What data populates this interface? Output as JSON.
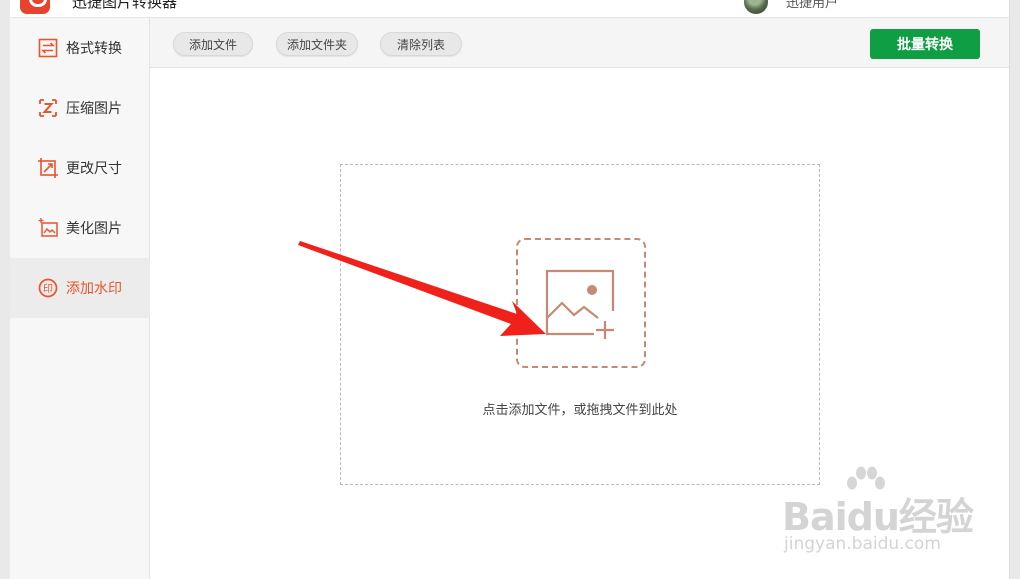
{
  "app": {
    "title": "迅捷图片转换器",
    "user_name": "迅捷用户"
  },
  "sidebar": {
    "items": [
      {
        "label": "格式转换",
        "icon": "convert-icon",
        "active": false
      },
      {
        "label": "压缩图片",
        "icon": "compress-icon",
        "active": false
      },
      {
        "label": "更改尺寸",
        "icon": "resize-icon",
        "active": false
      },
      {
        "label": "美化图片",
        "icon": "beautify-icon",
        "active": false
      },
      {
        "label": "添加水印",
        "icon": "watermark-icon",
        "active": true
      }
    ]
  },
  "toolbar": {
    "add_file_label": "添加文件",
    "add_folder_label": "添加文件夹",
    "clear_list_label": "清除列表",
    "batch_convert_label": "批量转换"
  },
  "dropzone": {
    "hint": "点击添加文件，或拖拽文件到此处",
    "icon": "add-image-icon"
  },
  "watermark": {
    "main": "Baidu经验",
    "sub": "jingyan.baidu.com"
  },
  "colors": {
    "accent": "#e8542d",
    "batch_button": "#0f9e43",
    "dropzone_icon": "#c48a75",
    "annotation_arrow": "#f0201a"
  }
}
